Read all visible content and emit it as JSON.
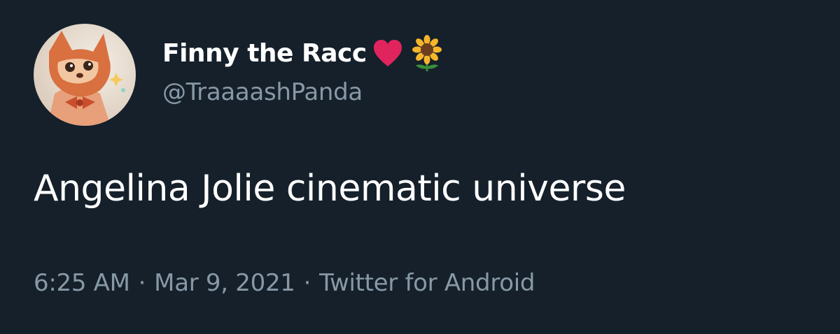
{
  "tweet": {
    "author": {
      "display_name": "Finny the Racc",
      "emojis": [
        "red-heart-icon",
        "sunflower-icon"
      ],
      "handle": "@TraaaashPanda",
      "avatar": "avatar-raccoon-illustration"
    },
    "text": "Angelina Jolie cinematic universe",
    "time": "6:25 AM",
    "separator": "·",
    "date": "Mar 9, 2021",
    "source": "Twitter for Android"
  },
  "colors": {
    "background": "#15202b",
    "primary_text": "#ffffff",
    "secondary_text": "#8899a6",
    "heart": "#e0245e",
    "sunflower_petals": "#f7b52b",
    "sunflower_center": "#6b3e1e",
    "stem": "#3a8f3a"
  }
}
